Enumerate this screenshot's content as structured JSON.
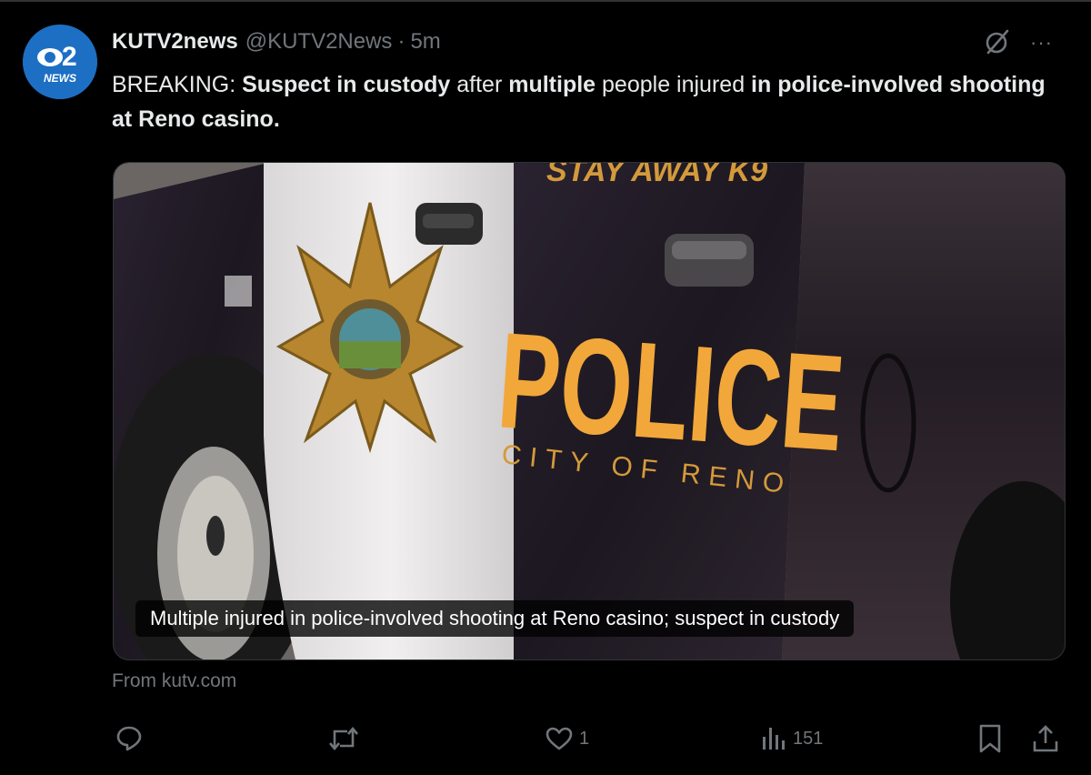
{
  "tweet": {
    "display_name": "KUTV2news",
    "handle": "@KUTV2News",
    "separator": "·",
    "time": "5m",
    "text_parts": [
      {
        "t": "BREAKING: ",
        "bold": false
      },
      {
        "t": "Suspect in custody",
        "bold": true
      },
      {
        "t": " after ",
        "bold": false
      },
      {
        "t": "multiple",
        "bold": true
      },
      {
        "t": " people injured ",
        "bold": false
      },
      {
        "t": "in police-involved shooting at Reno casino.",
        "bold": true
      }
    ],
    "more_label": "···"
  },
  "avatar": {
    "logo_number": "2",
    "logo_word": "NEWS"
  },
  "media": {
    "caption": "Multiple injured in police-involved shooting at Reno casino; suspect in custody",
    "vehicle_text_main": "POLICE",
    "vehicle_text_sub": "CITY OF RENO",
    "vehicle_text_top": "STAY AWAY K9"
  },
  "source_label": "From kutv.com",
  "actions": {
    "reply_count": "",
    "repost_count": "",
    "like_count": "1",
    "views_count": "151"
  },
  "colors": {
    "background": "#000000",
    "text": "#e7e9ea",
    "muted": "#71767b",
    "accent_blue": "#1d6fc4",
    "police_gold": "#f2a73a"
  }
}
